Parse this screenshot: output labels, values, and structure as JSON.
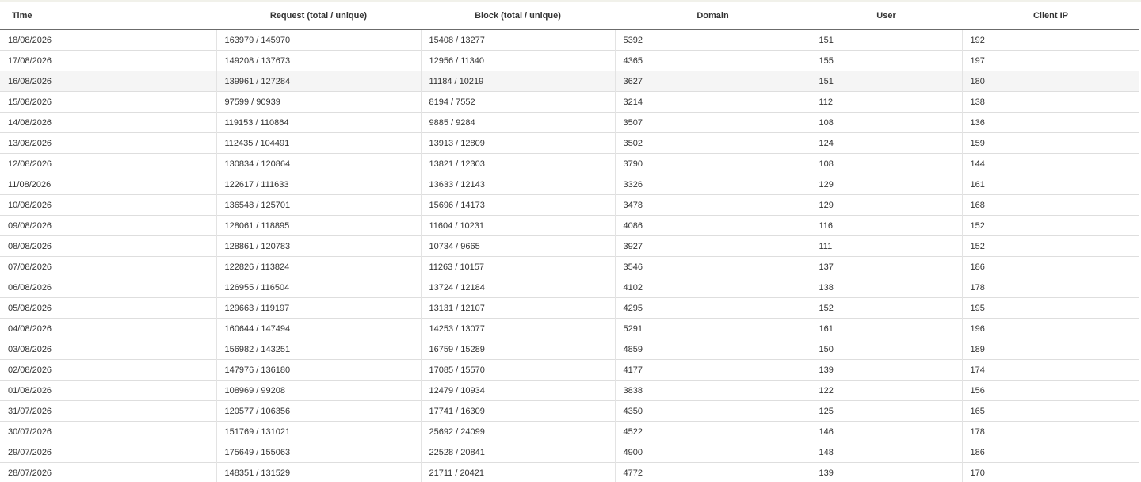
{
  "table": {
    "columns": [
      "Time",
      "Request (total / unique)",
      "Block (total / unique)",
      "Domain",
      "User",
      "Client IP"
    ],
    "highlighted_row_index": 2,
    "rows": [
      [
        "18/08/2026",
        "163979 / 145970",
        "15408 / 13277",
        "5392",
        "151",
        "192"
      ],
      [
        "17/08/2026",
        "149208 / 137673",
        "12956 / 11340",
        "4365",
        "155",
        "197"
      ],
      [
        "16/08/2026",
        "139961 / 127284",
        "11184 / 10219",
        "3627",
        "151",
        "180"
      ],
      [
        "15/08/2026",
        "97599 / 90939",
        "8194 / 7552",
        "3214",
        "112",
        "138"
      ],
      [
        "14/08/2026",
        "119153 / 110864",
        "9885 / 9284",
        "3507",
        "108",
        "136"
      ],
      [
        "13/08/2026",
        "112435 / 104491",
        "13913 / 12809",
        "3502",
        "124",
        "159"
      ],
      [
        "12/08/2026",
        "130834 / 120864",
        "13821 / 12303",
        "3790",
        "108",
        "144"
      ],
      [
        "11/08/2026",
        "122617 / 111633",
        "13633 / 12143",
        "3326",
        "129",
        "161"
      ],
      [
        "10/08/2026",
        "136548 / 125701",
        "15696 / 14173",
        "3478",
        "129",
        "168"
      ],
      [
        "09/08/2026",
        "128061 / 118895",
        "11604 / 10231",
        "4086",
        "116",
        "152"
      ],
      [
        "08/08/2026",
        "128861 / 120783",
        "10734 / 9665",
        "3927",
        "111",
        "152"
      ],
      [
        "07/08/2026",
        "122826 / 113824",
        "11263 / 10157",
        "3546",
        "137",
        "186"
      ],
      [
        "06/08/2026",
        "126955 / 116504",
        "13724 / 12184",
        "4102",
        "138",
        "178"
      ],
      [
        "05/08/2026",
        "129663 / 119197",
        "13131 / 12107",
        "4295",
        "152",
        "195"
      ],
      [
        "04/08/2026",
        "160644 / 147494",
        "14253 / 13077",
        "5291",
        "161",
        "196"
      ],
      [
        "03/08/2026",
        "156982 / 143251",
        "16759 / 15289",
        "4859",
        "150",
        "189"
      ],
      [
        "02/08/2026",
        "147976 / 136180",
        "17085 / 15570",
        "4177",
        "139",
        "174"
      ],
      [
        "01/08/2026",
        "108969 / 99208",
        "12479 / 10934",
        "3838",
        "122",
        "156"
      ],
      [
        "31/07/2026",
        "120577 / 106356",
        "17741 / 16309",
        "4350",
        "125",
        "165"
      ],
      [
        "30/07/2026",
        "151769 / 131021",
        "25692 / 24099",
        "4522",
        "146",
        "178"
      ],
      [
        "29/07/2026",
        "175649 / 155063",
        "22528 / 20841",
        "4900",
        "148",
        "186"
      ],
      [
        "28/07/2026",
        "148351 / 131529",
        "21711 / 20421",
        "4772",
        "139",
        "170"
      ]
    ]
  }
}
